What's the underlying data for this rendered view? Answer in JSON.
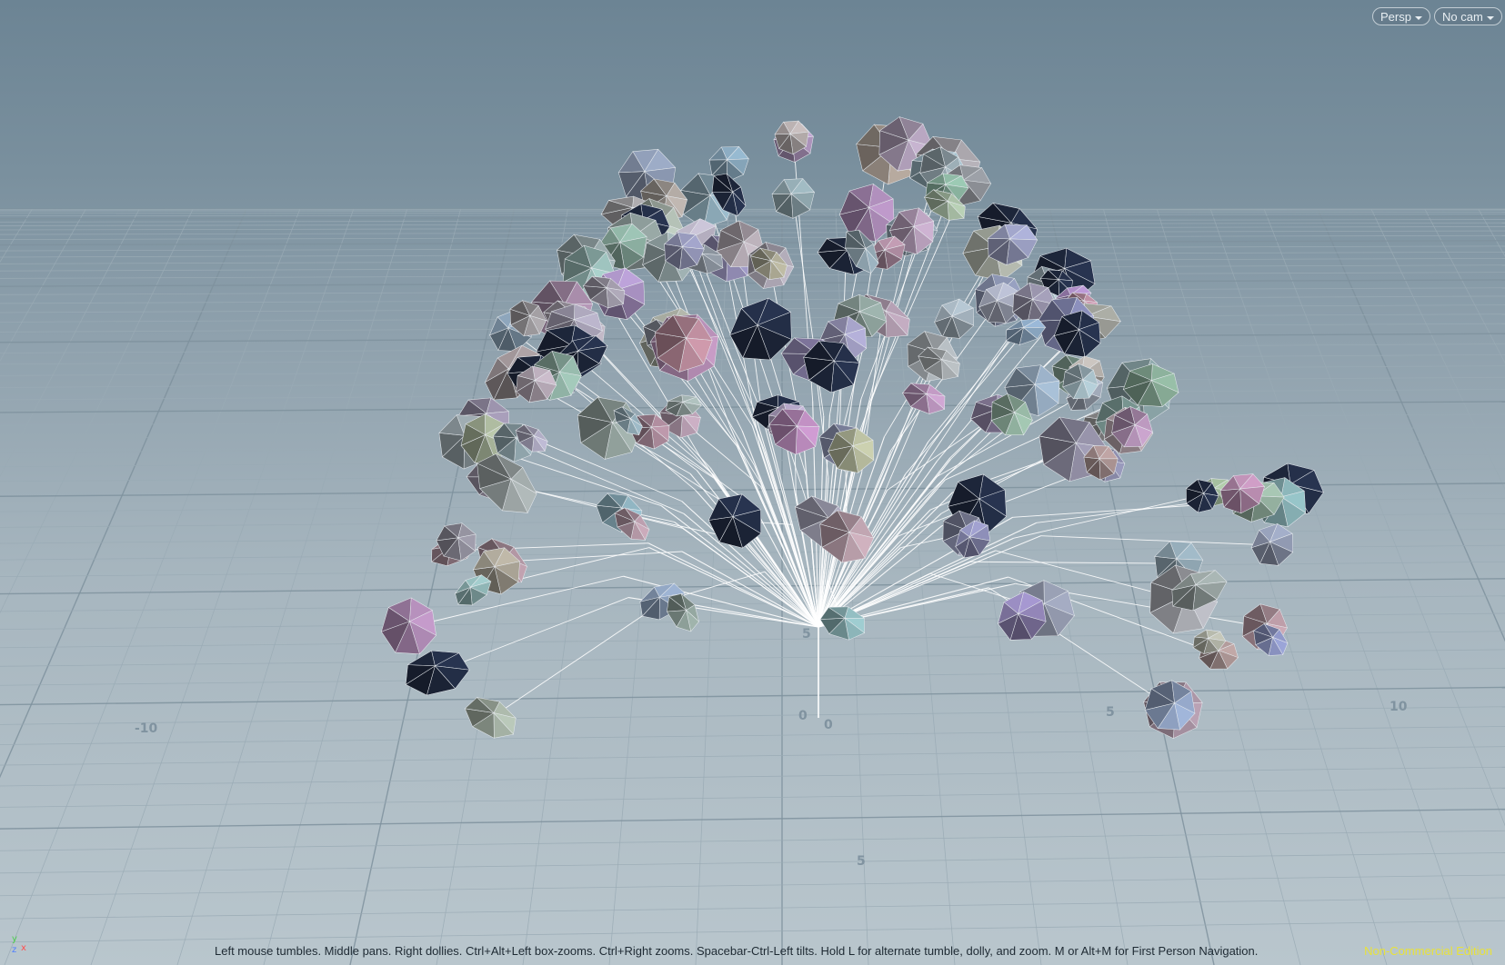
{
  "viewport": {
    "view_mode": "Persp",
    "camera": "No cam"
  },
  "grid_labels": {
    "x_neg10": "-10",
    "x_0": "0",
    "x_5": "5",
    "x_10": "10",
    "z_0": "0",
    "z_5_far": "5",
    "z_5_near": "5"
  },
  "axis_gizmo": {
    "y": "y",
    "z": "z",
    "x": "x"
  },
  "status_bar": {
    "hint": "Left mouse tumbles. Middle pans. Right dollies. Ctrl+Alt+Left box-zooms. Ctrl+Right zooms. Spacebar-Ctrl-Left tilts. Hold L for alternate tumble, dolly, and zoom.     M or Alt+M for First Person Navigation.",
    "edition": "Non-Commercial Edition"
  },
  "colors": {
    "edition_text": "#e8e23a",
    "stem": "#ffffff",
    "leaf_light": "#b8bcc6",
    "leaf_dark": "#2a3550"
  }
}
